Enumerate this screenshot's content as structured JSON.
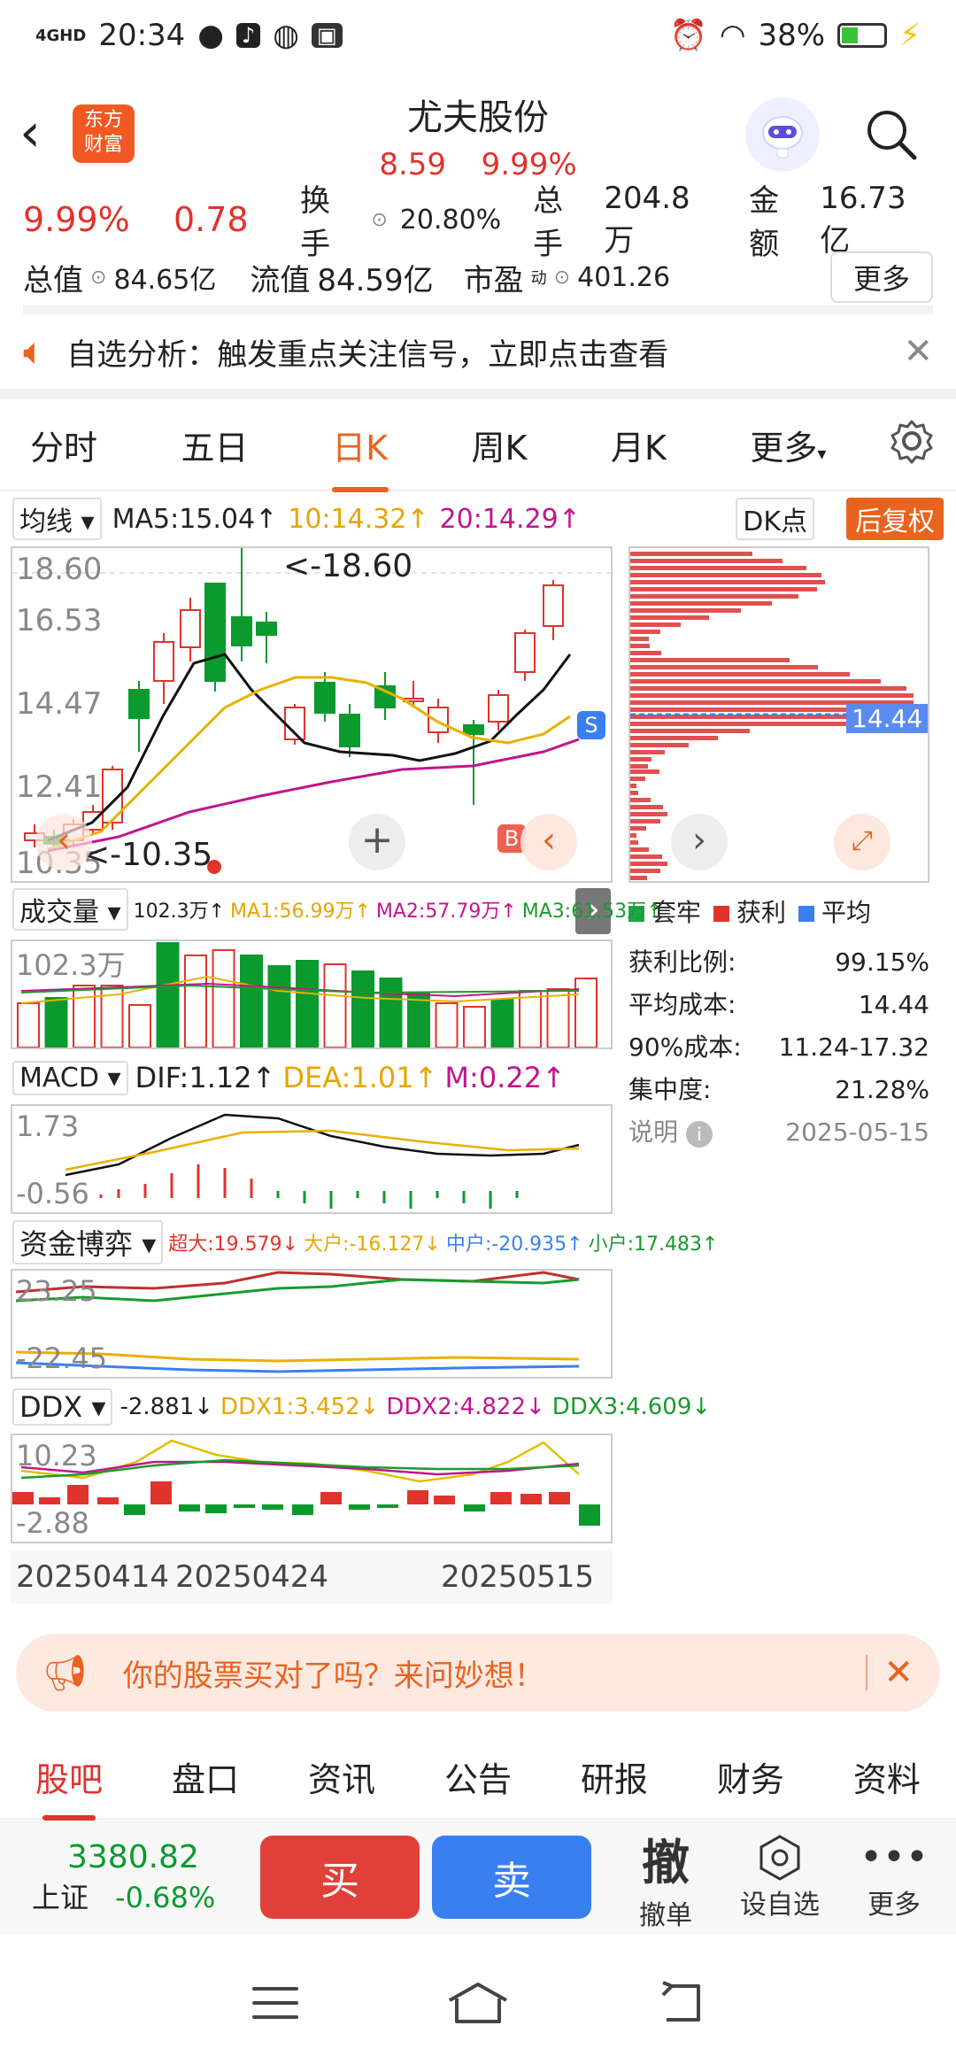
{
  "status": {
    "network": "4GHD",
    "time": "20:34",
    "battery": "38%"
  },
  "header": {
    "logo_line1": "东方",
    "logo_line2": "财富",
    "stock_name": "尤夫股份",
    "price": "8.59",
    "change_pct": "9.99%"
  },
  "quote": {
    "pct": "9.99%",
    "change": "0.78",
    "turnover_label": "换手",
    "turnover": "20.80%",
    "volume_label": "总手",
    "volume": "204.8万",
    "amount_label": "金额",
    "amount": "16.73亿",
    "mktcap_label": "总值",
    "mktcap": "84.65亿",
    "float_label": "流值",
    "float_cap": "84.59亿",
    "pe_label": "市盈",
    "pe_sup": "动",
    "pe": "401.26",
    "more": "更多"
  },
  "notice": {
    "text": "自选分析：触发重点关注信号，立即点击查看"
  },
  "tabs": [
    "分时",
    "五日",
    "日K",
    "周K",
    "月K",
    "更多"
  ],
  "active_tab": 2,
  "ma_row": {
    "select": "均线",
    "ma5": "MA5:15.04↑",
    "ma10": "10:14.32↑",
    "ma20": "20:14.29↑",
    "dk": "DK点",
    "adjust": "后复权"
  },
  "kchart": {
    "y_labels": [
      "18.60",
      "16.53",
      "14.47",
      "12.41",
      "10.35"
    ],
    "high_note": "<-18.60",
    "low_note": "<-10.35",
    "b_label": "B",
    "s_label": "S"
  },
  "chip_panel": {
    "price_tag": "14.44",
    "legend": [
      "套牢",
      "获利",
      "平均"
    ],
    "stats": [
      [
        "获利比例:",
        "99.15%"
      ],
      [
        "平均成本:",
        "14.44"
      ],
      [
        "90%成本:",
        "11.24-17.32"
      ],
      [
        "集中度:",
        "21.28%"
      ]
    ],
    "note_label": "说明",
    "date": "2025-05-15"
  },
  "volume": {
    "select": "成交量",
    "v": "102.3万↑",
    "ma1": "MA1:56.99万↑",
    "ma2": "MA2:57.79万↑",
    "ma3": "MA3:61.53万↑",
    "label": "102.3万"
  },
  "macd": {
    "select": "MACD",
    "dif": "DIF:1.12↑",
    "dea": "DEA:1.01↑",
    "m": "M:0.22↑",
    "top": "1.73",
    "bottom": "-0.56"
  },
  "fund": {
    "select": "资金博弈",
    "super": "超大:19.579↓",
    "big": "大户:-16.127↓",
    "mid": "中户:-20.935↑",
    "small": "小户:17.483↑",
    "top": "23.25",
    "bottom": "-22.45"
  },
  "ddx": {
    "select": "DDX",
    "v": "-2.881↓",
    "ddx1": "DDX1:3.452↓",
    "ddx2": "DDX2:4.822↓",
    "ddx3": "DDX3:4.609↓",
    "top": "10.23",
    "bottom": "-2.88"
  },
  "dates": [
    "20250414",
    "20250424",
    "20250515"
  ],
  "ad": {
    "text": "你的股票买对了吗？来问妙想！"
  },
  "bottom_tabs": [
    "股吧",
    "盘口",
    "资讯",
    "公告",
    "研报",
    "财务",
    "资料"
  ],
  "index": {
    "value": "3380.82",
    "name": "上证",
    "change": "-0.68%"
  },
  "trade": {
    "buy": "买",
    "sell": "卖",
    "cancel_big": "撤",
    "cancel": "撤单",
    "watch": "设自选",
    "more": "更多"
  },
  "colors": {
    "up": "#e0332c",
    "down": "#0a9a2e",
    "accent": "#e8631f",
    "buy": "#e0403a",
    "sell": "#3a7ff0"
  }
}
